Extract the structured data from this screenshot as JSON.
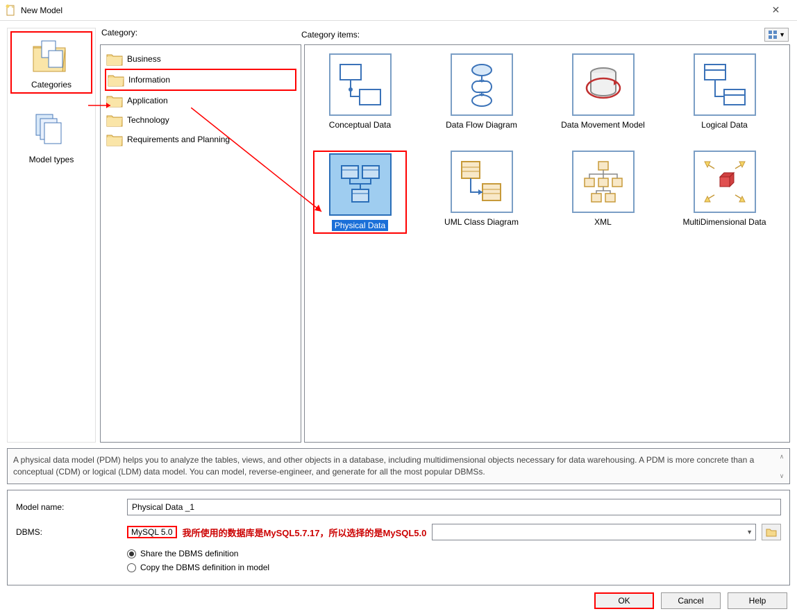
{
  "window": {
    "title": "New Model"
  },
  "leftPanel": {
    "items": [
      {
        "label": "Categories"
      },
      {
        "label": "Model types"
      }
    ]
  },
  "headers": {
    "category": "Category:",
    "items": "Category items:"
  },
  "tree": {
    "items": [
      {
        "label": "Business"
      },
      {
        "label": "Information"
      },
      {
        "label": "Application"
      },
      {
        "label": "Technology"
      },
      {
        "label": "Requirements and Planning"
      }
    ]
  },
  "categoryItems": [
    {
      "label": "Conceptual Data"
    },
    {
      "label": "Data Flow Diagram"
    },
    {
      "label": "Data Movement Model"
    },
    {
      "label": "Logical Data"
    },
    {
      "label": "Physical Data"
    },
    {
      "label": "UML Class Diagram"
    },
    {
      "label": "XML"
    },
    {
      "label": "MultiDimensional Data"
    }
  ],
  "description": "A physical data model (PDM) helps you to analyze the tables, views, and other objects in a database, including multidimensional objects necessary for data warehousing. A PDM is more concrete than a conceptual (CDM) or logical (LDM) data model. You can model, reverse-engineer, and generate for all the most popular DBMSs.",
  "form": {
    "modelNameLabel": "Model name:",
    "modelNameValue": "Physical Data _1",
    "dbmsLabel": "DBMS:",
    "dbmsValue": "MySQL 5.0",
    "dbmsNote": "我所使用的数据库是MySQL5.7.17，所以选择的是MySQL5.0",
    "radio1": "Share the DBMS definition",
    "radio2": "Copy the DBMS definition in model"
  },
  "buttons": {
    "ok": "OK",
    "cancel": "Cancel",
    "help": "Help"
  }
}
